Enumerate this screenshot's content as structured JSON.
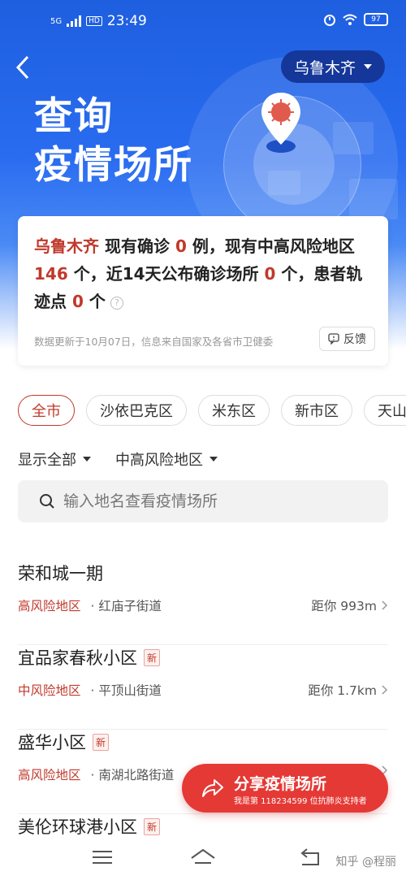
{
  "status_bar": {
    "signal": "5G",
    "hd": "HD",
    "time": "23:49",
    "battery": "97"
  },
  "header": {
    "city": "乌鲁木齐",
    "title_line1": "查询",
    "title_line2": "疫情场所"
  },
  "summary": {
    "city": "乌鲁木齐",
    "t1": " 现有确诊 ",
    "confirmed": "0",
    "t2": " 例，现有中高风险地区",
    "risk_areas": "146",
    "t3": " 个，近14天公布确诊场所 ",
    "places": "0",
    "t4": " 个，患者轨迹点 ",
    "track_points": "0",
    "t5": " 个",
    "note": "数据更新于10月07日，信息来自国家及各省市卫健委",
    "feedback": "反馈"
  },
  "districts": [
    "全市",
    "沙依巴克区",
    "米东区",
    "新市区",
    "天山区"
  ],
  "filters": {
    "show": "显示全部",
    "risk": "中高风险地区"
  },
  "search": {
    "placeholder": "输入地名查看疫情场所"
  },
  "places": [
    {
      "name": "荣和城一期",
      "is_new": "",
      "risk": "高风险地区",
      "street": "· 红庙子街道",
      "distance": "距你 993m"
    },
    {
      "name": "宜品家春秋小区",
      "is_new": "新",
      "risk": "中风险地区",
      "street": "· 平顶山街道",
      "distance": "距你 1.7km"
    },
    {
      "name": "盛华小区",
      "is_new": "新",
      "risk": "高风险地区",
      "street": "· 南湖北路街道",
      "distance": ""
    },
    {
      "name": "美伦环球港小区",
      "is_new": "新",
      "risk": "",
      "street": "",
      "distance": ""
    }
  ],
  "share": {
    "label": "分享疫情场所",
    "sub": "我是第 118234599 位抗肺炎支持者"
  },
  "watermark": "知乎 @程丽",
  "colors": {
    "primary_blue": "#2a6cf0",
    "accent_red": "#c0392b",
    "share_red": "#e53935"
  }
}
